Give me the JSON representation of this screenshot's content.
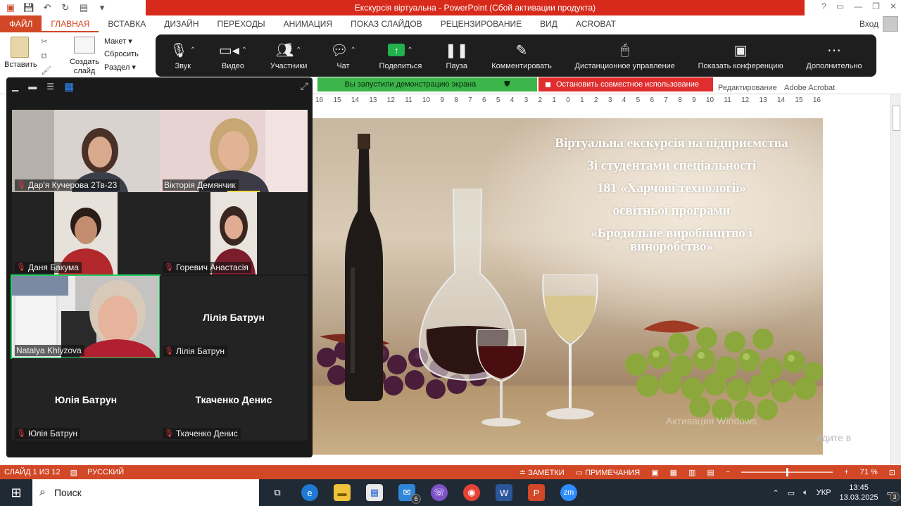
{
  "window": {
    "title": "Екскурсія віртуальна - PowerPoint (Сбой активации продукта)",
    "controls": [
      "?",
      "□",
      "—",
      "□",
      "✕"
    ]
  },
  "ribbon": {
    "tabs": [
      "ФАЙЛ",
      "ГЛАВНАЯ",
      "ВСТАВКА",
      "ДИЗАЙН",
      "ПЕРЕХОДЫ",
      "АНИМАЦИЯ",
      "ПОКАЗ СЛАЙДОВ",
      "РЕЦЕНЗИРОВАНИЕ",
      "ВИД",
      "ACROBAT"
    ],
    "signin": "Вход",
    "paste": "Вставить",
    "create_slide": "Создать слайд",
    "layout": "Макет",
    "reset": "Сбросить",
    "section": "Раздел",
    "group_editing": "Редактирование",
    "group_acrobat": "Adobe Acrobat"
  },
  "zoom_toolbar": {
    "audio": "Звук",
    "video": "Видео",
    "participants": "Участники",
    "participants_count": "8",
    "chat": "Чат",
    "share": "Поделиться",
    "pause": "Пауза",
    "annotate": "Комментировать",
    "remote_control": "Дистанционное управление",
    "show_conference": "Показать конференцию",
    "more": "Дополнительно"
  },
  "share_banner": {
    "status": "Вы запустили демонстрацию экрана",
    "stop": "Остановить совместное использование"
  },
  "ruler": [
    "16",
    "15",
    "14",
    "13",
    "12",
    "11",
    "10",
    "9",
    "8",
    "7",
    "6",
    "5",
    "4",
    "3",
    "2",
    "1",
    "0",
    "1",
    "2",
    "3",
    "4",
    "5",
    "6",
    "7",
    "8",
    "9",
    "10",
    "11",
    "12",
    "13",
    "14",
    "15",
    "16"
  ],
  "slide": {
    "lines": [
      "Віртуальна екскурсія на підприємства",
      "Зі студентами спеціальності",
      "181 «Харчові технології»",
      "освітньої програми",
      "«Бродильне виробництво і",
      "виноробство»"
    ],
    "watermark": "Активация Windows",
    "watermark2": "йдите в"
  },
  "gallery": {
    "participants": [
      {
        "name": "Дар'я Кучерова 2Тв-23",
        "muted": true,
        "video": true
      },
      {
        "name": "Вікторія Демянчик",
        "muted": false,
        "video": true
      },
      {
        "name": "Даня Бакума",
        "muted": true,
        "video": true
      },
      {
        "name": "Горевич Анастасія",
        "muted": true,
        "video": true
      },
      {
        "name": "Natalya Khlyzova",
        "muted": false,
        "video": true,
        "speaking": true
      },
      {
        "name": "Лілія Батрун",
        "muted": true,
        "video": false
      },
      {
        "name": "Юлія Батрун",
        "muted": true,
        "video": false
      },
      {
        "name": "Ткаченко Денис",
        "muted": true,
        "video": false
      }
    ]
  },
  "statusbar": {
    "slide": "СЛАЙД 1 ИЗ 12",
    "language": "РУССКИЙ",
    "notes": "ЗАМЕТКИ",
    "comments": "ПРИМЕЧАНИЯ",
    "zoom": "71 %"
  },
  "taskbar": {
    "search": "Поиск",
    "mail_badge": "6",
    "language": "УКР",
    "time": "13:45",
    "date": "13.03.2025",
    "notifications": "3"
  },
  "colors": {
    "ppt_accent": "#d24726",
    "title_red": "#d72a1a",
    "zoom_dark": "#1e1e1e",
    "share_green": "#3cb54a",
    "stop_red": "#e02d2d",
    "speaker_outline": "#23d160"
  }
}
